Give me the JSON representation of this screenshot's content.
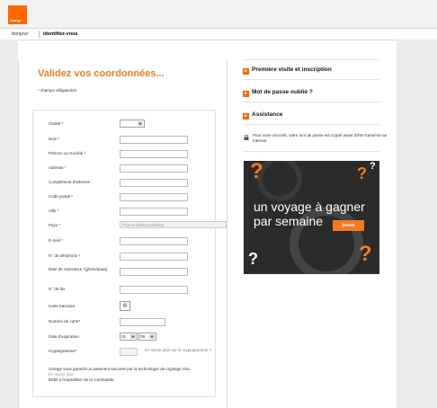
{
  "brand": {
    "logo_text": "orange",
    "color": "#ff6600",
    "title_color": "#f07a1e"
  },
  "nav": {
    "hello": "bonjour",
    "login": "identifiez-vous"
  },
  "form": {
    "title": "Validez vos coordonnées...",
    "required_note": "* champs obligatoires",
    "fields": {
      "civilite": "Civilité *",
      "nom": "Nom *",
      "prenom": "Prénom ou Société *",
      "adresse": "Adresse *",
      "complement": "Complément d'adresse :",
      "code_postal": "Code postal *",
      "ville": "Ville *",
      "pays": "Pays *",
      "email": "E-mail *",
      "telephone": "N° de téléphone *",
      "naissance": "Date de naissance *(jj/mm/aaaa)",
      "fax": "N° de fax",
      "carte_bancaire": "Carte bancaire",
      "numero_carte": "Numéro de carte*",
      "expiration": "Date d'expiration",
      "cryptogramme": "Cryptogramme*"
    },
    "pays_value": "France (Métropolitaine)",
    "exp_month": "01",
    "exp_year": "08",
    "crypto_help": "En savoir plus sur le cryptogramme ?",
    "ssl_note": "Orange vous garantit un paiement sécurisé par la technologie de cryptage SSL.",
    "ssl_more": "En savoir plus",
    "debit_note": "Débit à l'expédition de la commande."
  },
  "sidebar": {
    "links": [
      "Première visite et inscription",
      "Mot de passe oublié ?",
      "Assistance"
    ],
    "security_note": "Pour votre sécurité, votre mot de passe est crypté avant d'être transmis sur Internet"
  },
  "ad": {
    "line1": "un voyage à gagner",
    "line2": "par semaine",
    "button": "jouez",
    "mark": "?"
  }
}
